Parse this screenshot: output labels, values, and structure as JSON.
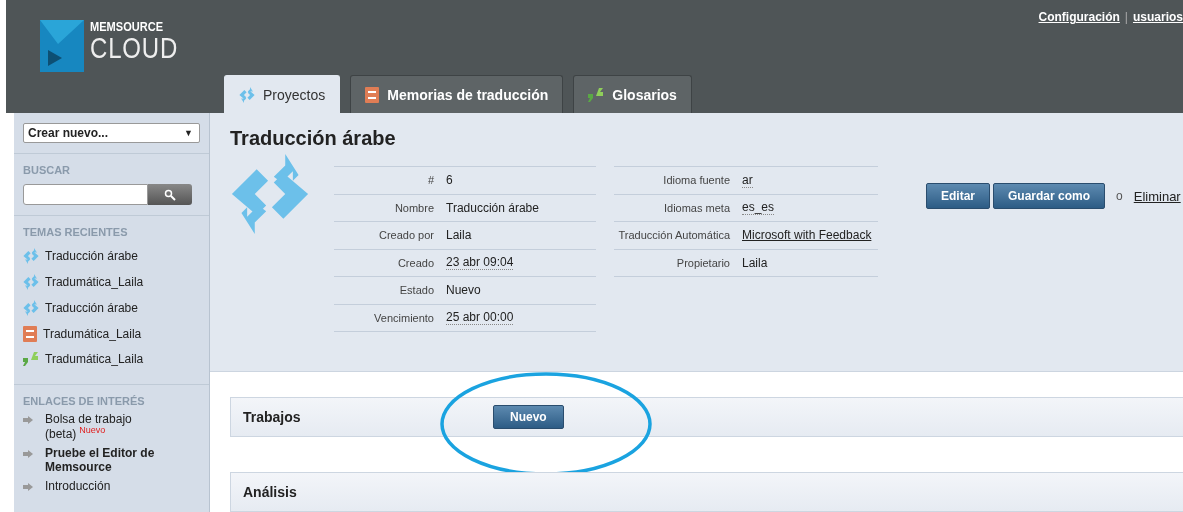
{
  "header": {
    "logo": {
      "top": "MEMSOURCE",
      "bottom": "CLOUD"
    },
    "top_links": [
      "Configuración",
      "usuarios"
    ],
    "link_separator": "|",
    "tabs": [
      {
        "label": "Proyectos",
        "kind": "project",
        "selected": true
      },
      {
        "label": "Memorias de traducción",
        "kind": "memory",
        "selected": false
      },
      {
        "label": "Glosarios",
        "kind": "glossary",
        "selected": false
      }
    ]
  },
  "sidebar": {
    "create_select": "Crear nuevo...",
    "select_caret": "▼",
    "search_heading": "BUSCAR",
    "recent_heading": "TEMAS RECIENTES",
    "recent": [
      {
        "label": "Traducción árabe",
        "kind": "project"
      },
      {
        "label": "Tradumática_Laila",
        "kind": "project"
      },
      {
        "label": "Traducción árabe",
        "kind": "project"
      },
      {
        "label": "Tradumática_Laila",
        "kind": "memory"
      },
      {
        "label": "Tradumática_Laila",
        "kind": "glossary"
      }
    ],
    "links_heading": "ENLACES DE INTERÉS",
    "links": [
      {
        "label": "Bolsa de trabajo (beta)",
        "badge": "Nuevo",
        "bold": false
      },
      {
        "label": "Pruebe el Editor de Memsource",
        "bold": true
      },
      {
        "label": "Introducción",
        "bold": false
      }
    ]
  },
  "project": {
    "title": "Traducción árabe",
    "fields_left": [
      {
        "label": "#",
        "value": "6",
        "kind": "text"
      },
      {
        "label": "Nombre",
        "value": "Traducción árabe",
        "kind": "text"
      },
      {
        "label": "Creado por",
        "value": "Laila",
        "kind": "text"
      },
      {
        "label": "Creado",
        "value": "23 abr 09:04",
        "kind": "dotted"
      },
      {
        "label": "Estado",
        "value": "Nuevo",
        "kind": "text"
      },
      {
        "label": "Vencimiento",
        "value": "25 abr 00:00",
        "kind": "dotted"
      }
    ],
    "fields_right": [
      {
        "label": "Idioma fuente",
        "value": "ar",
        "kind": "dotted"
      },
      {
        "label": "Idiomas meta",
        "value": "es_es",
        "kind": "dotted"
      },
      {
        "label": "Traducción Automática",
        "value": "Microsoft with Feedback",
        "kind": "link"
      },
      {
        "label": "Propietario",
        "value": "Laila",
        "kind": "text"
      }
    ],
    "buttons": [
      "Editar",
      "Guardar como"
    ],
    "or": "o",
    "delete_link": "Eliminar"
  },
  "sections": [
    {
      "title": "Trabajos",
      "button": "Nuevo",
      "highlighted": true
    },
    {
      "title": "Análisis",
      "highlighted": false
    }
  ]
}
